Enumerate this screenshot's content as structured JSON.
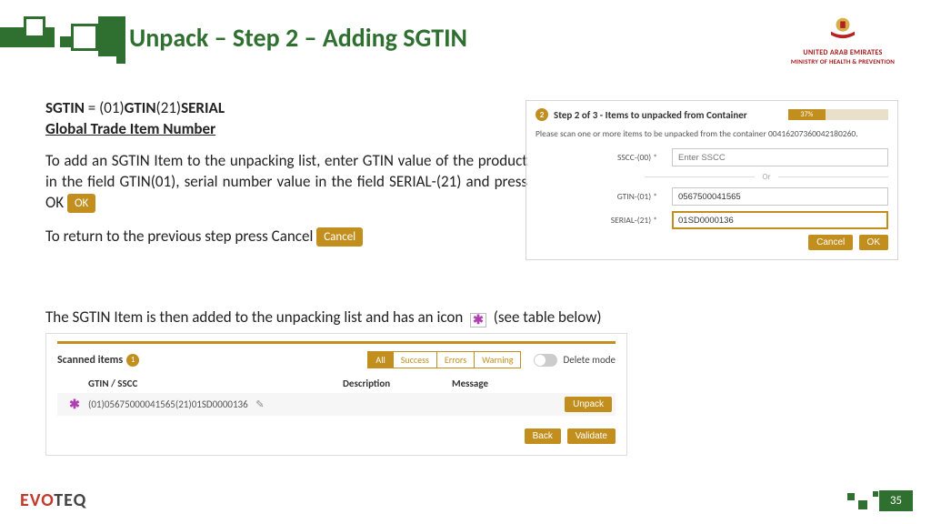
{
  "header": {
    "title": "Unpack – Step 2 – Adding SGTIN",
    "ministry_line1": "UNITED ARAB EMIRATES",
    "ministry_line2": "MINISTRY OF HEALTH & PREVENTION"
  },
  "body": {
    "def_prefix": "SGTIN",
    "def_equals": " = (01)",
    "def_gtin": "GTIN",
    "def_mid": "(21)",
    "def_serial": "SERIAL",
    "underline": "Global Trade Item Number",
    "para1": "To add an SGTIN Item to the unpacking list, enter GTIN value of the product in the field GTIN(01), serial number value in the field SERIAL-(21) and press OK",
    "chip_ok": "OK",
    "para2": "To return to the previous step press Cancel",
    "chip_cancel": "Cancel",
    "below": "The SGTIN Item is then added to the unpacking list and has an icon",
    "below_tail": "(see table below)",
    "star": "✱"
  },
  "wizard": {
    "step_num": "2",
    "title": "Step 2 of 3 - Items to unpacked from Container",
    "progress_pct": "37%",
    "instruction": "Please scan one or more items to be unpacked from the container 00416207360042180260.",
    "sscc_label": "SSCC-(00) *",
    "sscc_placeholder": "Enter SSCC",
    "or": "Or",
    "gtin_label": "GTIN-(01) *",
    "gtin_value": "0567500041565",
    "serial_label": "SERIAL-(21) *",
    "serial_value": "01SD0000136",
    "cancel": "Cancel",
    "ok": "OK"
  },
  "scan": {
    "title": "Scanned items",
    "count": "1",
    "filter_all": "All",
    "filter_success": "Success",
    "filter_errors": "Errors",
    "filter_warning": "Warning",
    "delete_mode": "Delete mode",
    "col_gtin": "GTIN / SSCC",
    "col_desc": "Description",
    "col_msg": "Message",
    "row_star": "✱",
    "row_value": "(01)05675000041565(21)01SD0000136",
    "edit": "✎",
    "unpack": "Unpack",
    "back": "Back",
    "validate": "Validate"
  },
  "footer": {
    "logo_a": "EVO",
    "logo_b": "TEQ",
    "page": "35"
  }
}
